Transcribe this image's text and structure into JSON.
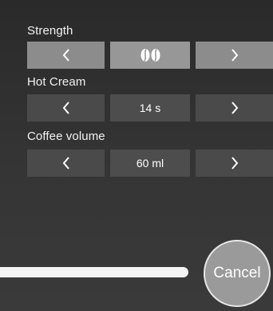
{
  "settings": {
    "strength": {
      "label": "Strength",
      "value_icon": "coffee-beans-icon",
      "bean_count": 2,
      "decrease_icon": "chevron-left-icon",
      "increase_icon": "chevron-right-icon"
    },
    "hot_cream": {
      "label": "Hot Cream",
      "value": "14 s",
      "decrease_icon": "chevron-left-icon",
      "increase_icon": "chevron-right-icon"
    },
    "coffee_volume": {
      "label": "Coffee volume",
      "value": "60 ml",
      "decrease_icon": "chevron-left-icon",
      "increase_icon": "chevron-right-icon"
    }
  },
  "footer": {
    "cancel_label": "Cancel"
  },
  "colors": {
    "background": "#2c2c2c",
    "strength_row": "#8c8c8c",
    "dark_row": "#4a4a4a",
    "cancel_button": "#9a9a9a",
    "slider": "#f4f4f4"
  }
}
